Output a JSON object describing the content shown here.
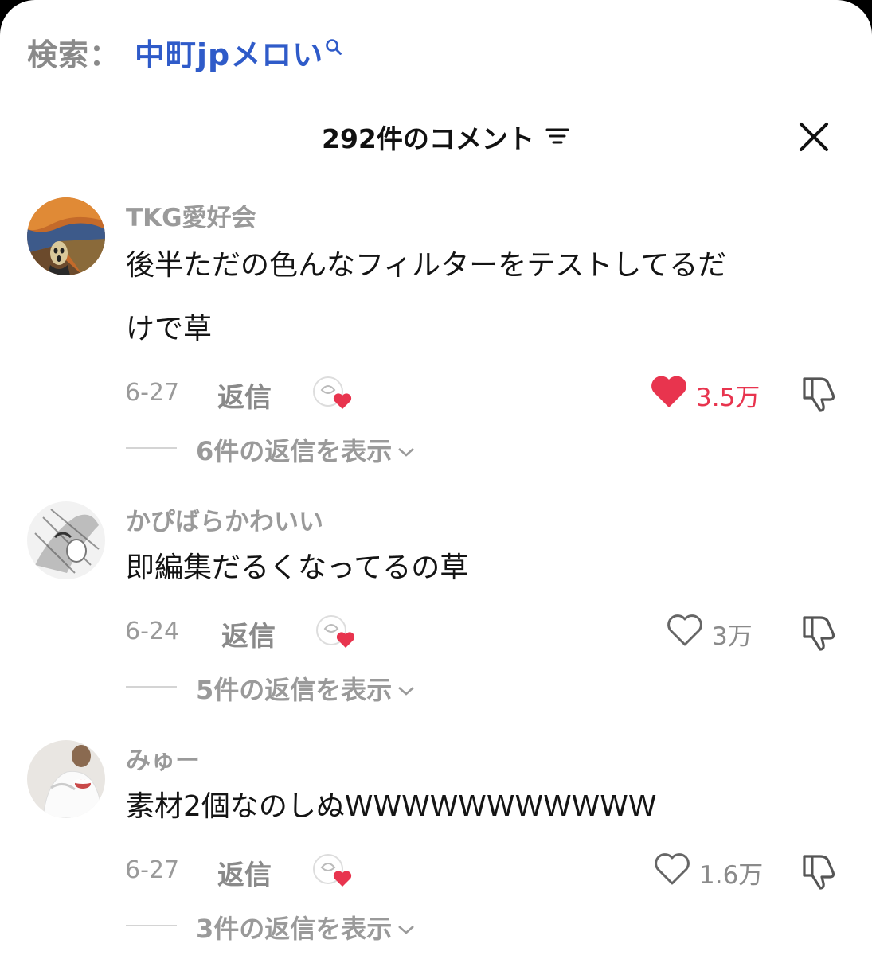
{
  "search": {
    "label": "検索：",
    "query": "中町jpメロい"
  },
  "header": {
    "title": "292件のコメント"
  },
  "comments": [
    {
      "username": "TKG愛好会",
      "text_line1": "後半ただの色んなフィルターをテストしてるだ",
      "text_line2": "けで草",
      "date": "6-27",
      "reply_label": "返信",
      "likes": "3.5万",
      "liked": true,
      "view_replies": "6件の返信を表示"
    },
    {
      "username": "かぴばらかわいい",
      "text_line1": "即編集だるくなってるの草",
      "date": "6-24",
      "reply_label": "返信",
      "likes": "3万",
      "liked": false,
      "view_replies": "5件の返信を表示"
    },
    {
      "username": "みゅー",
      "text_line1": "素材2個なのしぬWWWWWWWWWWW",
      "date": "6-27",
      "reply_label": "返信",
      "likes": "1.6万",
      "liked": false,
      "view_replies": "3件の返信を表示"
    }
  ],
  "colors": {
    "accent": "#2f5bc9",
    "like_red": "#e8344e",
    "muted": "#9a9a9a"
  }
}
